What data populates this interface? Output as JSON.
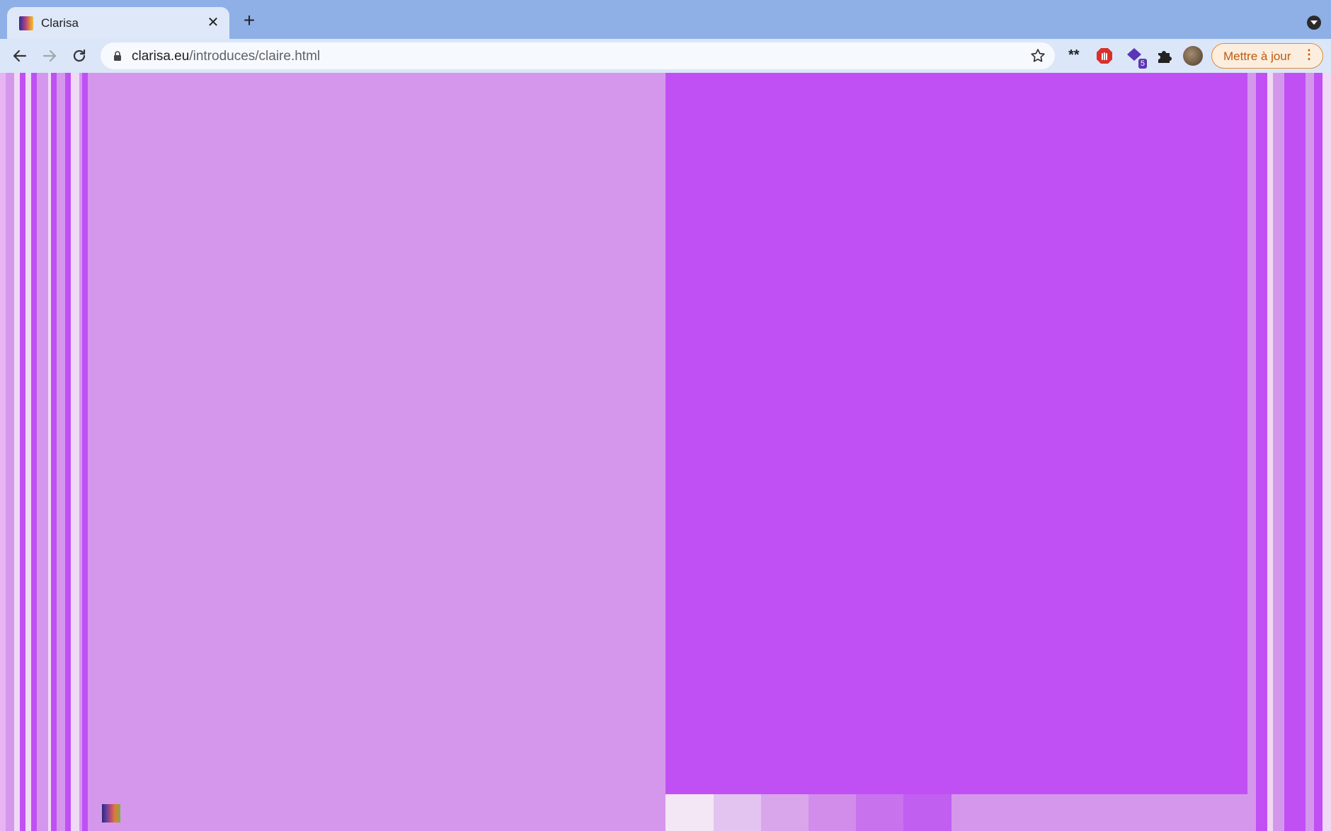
{
  "browser": {
    "tab": {
      "title": "Clarisa",
      "close_icon": "close-icon"
    },
    "new_tab_icon": "plus-icon",
    "tab_search_icon": "chevron-down-icon",
    "url": {
      "domain": "clarisa.eu",
      "path": "/introduces/claire.html"
    },
    "extensions": [
      {
        "name": "asterisks-extension",
        "label": "**"
      },
      {
        "name": "adblock-extension"
      },
      {
        "name": "shape-extension",
        "badge": "5"
      },
      {
        "name": "puzzle-extensions"
      }
    ],
    "update_button": {
      "label": "Mettre à jour",
      "menu_icon": "⋮"
    }
  },
  "colors": {
    "light_purple": "#d597ec",
    "bright_purple": "#c050f4",
    "pale": "#efd9f5"
  },
  "swatches": [
    "#f3e6f5",
    "#e3c3f0",
    "#d9a6ec",
    "#d18de9",
    "#c873ed",
    "#c05ff0",
    "#d597ec"
  ]
}
